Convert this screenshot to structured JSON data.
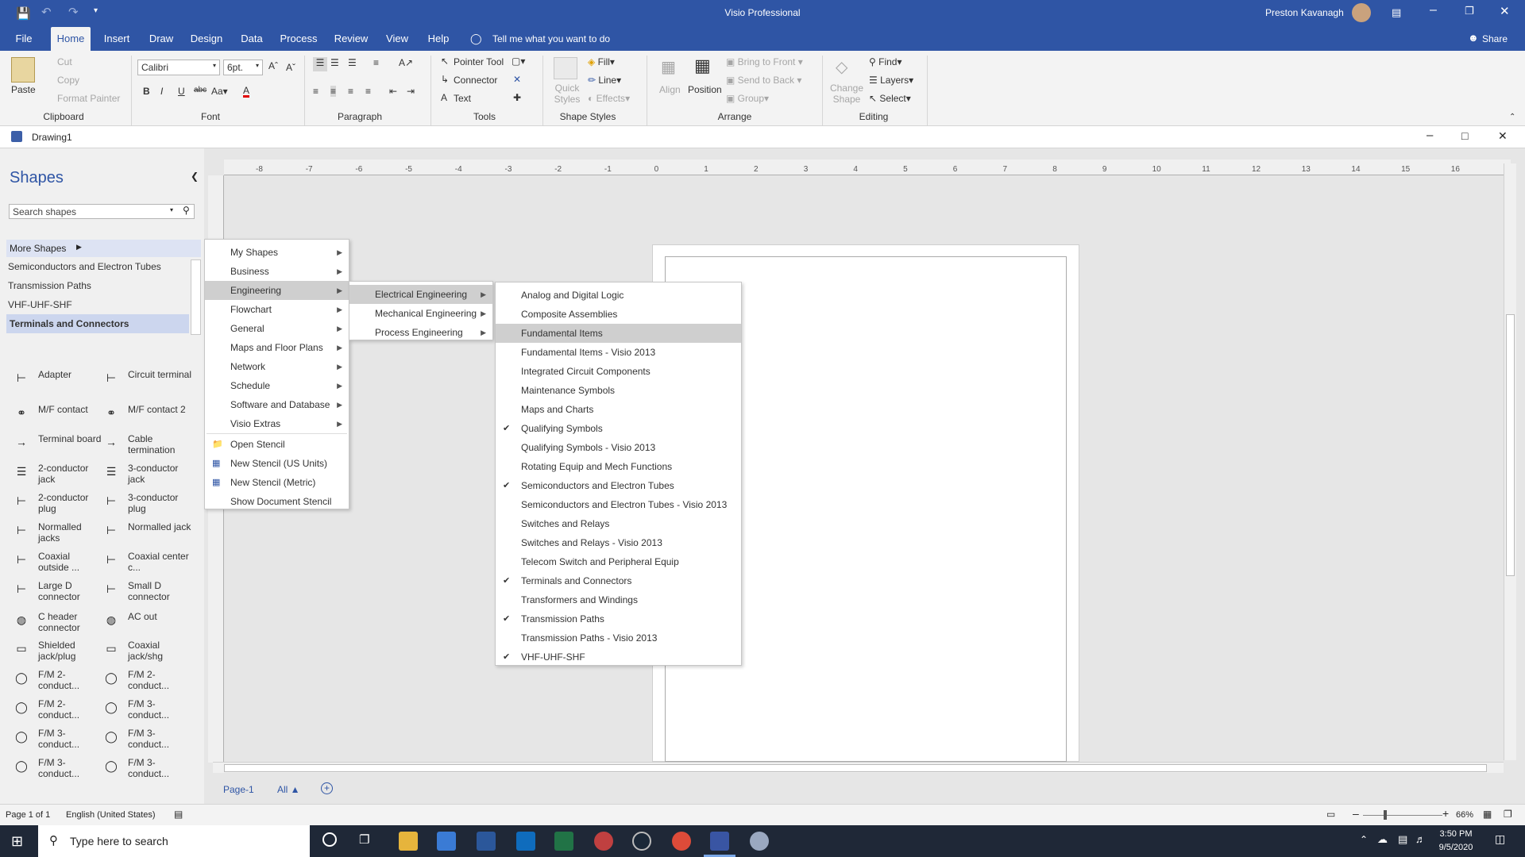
{
  "app": {
    "title": "Visio Professional",
    "user": "Preston Kavanagh",
    "tell_me": "Tell me what you want to do",
    "share": "Share"
  },
  "tabs": [
    "File",
    "Home",
    "Insert",
    "Draw",
    "Design",
    "Data",
    "Process",
    "Review",
    "View",
    "Help"
  ],
  "ribbon": {
    "clipboard": {
      "paste": "Paste",
      "cut": "Cut",
      "copy": "Copy",
      "format_painter": "Format Painter",
      "group": "Clipboard"
    },
    "font": {
      "family": "Calibri",
      "size": "6pt.",
      "group": "Font"
    },
    "paragraph": {
      "group": "Paragraph"
    },
    "tools": {
      "pointer": "Pointer Tool",
      "connector": "Connector",
      "text": "Text",
      "group": "Tools"
    },
    "shape_styles": {
      "quick_styles": "Quick Styles",
      "fill": "Fill",
      "line": "Line",
      "effects": "Effects",
      "group": "Shape Styles"
    },
    "arrange": {
      "align": "Align",
      "position": "Position",
      "bring_front": "Bring to Front",
      "send_back": "Send to Back",
      "group_btn": "Group",
      "group": "Arrange"
    },
    "editing": {
      "change_shape": "Change Shape",
      "find": "Find",
      "layers": "Layers",
      "select": "Select",
      "group": "Editing"
    }
  },
  "document": {
    "name": "Drawing1"
  },
  "shapes_panel": {
    "title": "Shapes",
    "search_placeholder": "Search shapes",
    "more_shapes": "More Shapes",
    "stencils": [
      "Semiconductors and Electron Tubes",
      "Transmission Paths",
      "VHF-UHF-SHF",
      "Terminals and Connectors"
    ],
    "items": [
      [
        "Adapter",
        "Circuit terminal"
      ],
      [
        "M/F contact",
        "M/F contact 2"
      ],
      [
        "Terminal board",
        "Cable termination"
      ],
      [
        "2-conductor jack",
        "3-conductor jack"
      ],
      [
        "2-conductor plug",
        "3-conductor plug"
      ],
      [
        "Normalled jacks",
        "Normalled jack"
      ],
      [
        "Coaxial outside ...",
        "Coaxial center c..."
      ],
      [
        "Large D connector",
        "Small D connector"
      ],
      [
        "C header connector",
        "AC out"
      ],
      [
        "Shielded jack/plug",
        "Coaxial jack/shg"
      ],
      [
        "F/M 2-conduct...",
        "F/M 2-conduct..."
      ],
      [
        "F/M 2-conduct...",
        "F/M 3-conduct..."
      ],
      [
        "F/M 3-conduct...",
        "F/M 3-conduct..."
      ],
      [
        "F/M 3-conduct...",
        "F/M 3-conduct..."
      ]
    ]
  },
  "menu1": [
    "My Shapes",
    "Business",
    "Engineering",
    "Flowchart",
    "General",
    "Maps and Floor Plans",
    "Network",
    "Schedule",
    "Software and Database",
    "Visio Extras",
    "Open Stencil",
    "New Stencil (US Units)",
    "New Stencil (Metric)",
    "Show Document Stencil"
  ],
  "menu2": [
    "Electrical Engineering",
    "Mechanical Engineering",
    "Process Engineering"
  ],
  "menu3": [
    {
      "label": "Analog and Digital Logic",
      "checked": false
    },
    {
      "label": "Composite Assemblies",
      "checked": false
    },
    {
      "label": "Fundamental Items",
      "checked": false
    },
    {
      "label": "Fundamental Items - Visio 2013",
      "checked": false
    },
    {
      "label": "Integrated Circuit Components",
      "checked": false
    },
    {
      "label": "Maintenance Symbols",
      "checked": false
    },
    {
      "label": "Maps and Charts",
      "checked": false
    },
    {
      "label": "Qualifying Symbols",
      "checked": true
    },
    {
      "label": "Qualifying Symbols - Visio 2013",
      "checked": false
    },
    {
      "label": "Rotating Equip and Mech Functions",
      "checked": false
    },
    {
      "label": "Semiconductors and Electron Tubes",
      "checked": true
    },
    {
      "label": "Semiconductors and Electron Tubes - Visio 2013",
      "checked": false
    },
    {
      "label": "Switches and Relays",
      "checked": false
    },
    {
      "label": "Switches and Relays - Visio 2013",
      "checked": false
    },
    {
      "label": "Telecom Switch and Peripheral Equip",
      "checked": false
    },
    {
      "label": "Terminals and Connectors",
      "checked": true
    },
    {
      "label": "Transformers and Windings",
      "checked": false
    },
    {
      "label": "Transmission Paths",
      "checked": true
    },
    {
      "label": "Transmission Paths - Visio 2013",
      "checked": false
    },
    {
      "label": "VHF-UHF-SHF",
      "checked": true
    }
  ],
  "ruler_ticks": [
    "-8",
    "-7",
    "-6",
    "-5",
    "-4",
    "-3",
    "-2",
    "-1",
    "0",
    "1",
    "2",
    "3",
    "4",
    "5",
    "6",
    "7",
    "8",
    "9",
    "10",
    "11",
    "12",
    "13",
    "14",
    "15",
    "16"
  ],
  "page_tabs": {
    "page": "Page-1",
    "all": "All"
  },
  "status": {
    "page": "Page 1 of 1",
    "language": "English (United States)",
    "zoom": "66%"
  },
  "taskbar": {
    "search": "Type here to search",
    "time": "3:50 PM",
    "date": "9/5/2020"
  },
  "colors": {
    "brand": "#2f55a5",
    "taskbar": "#1f2837",
    "highlight": "#cfcfcf"
  }
}
